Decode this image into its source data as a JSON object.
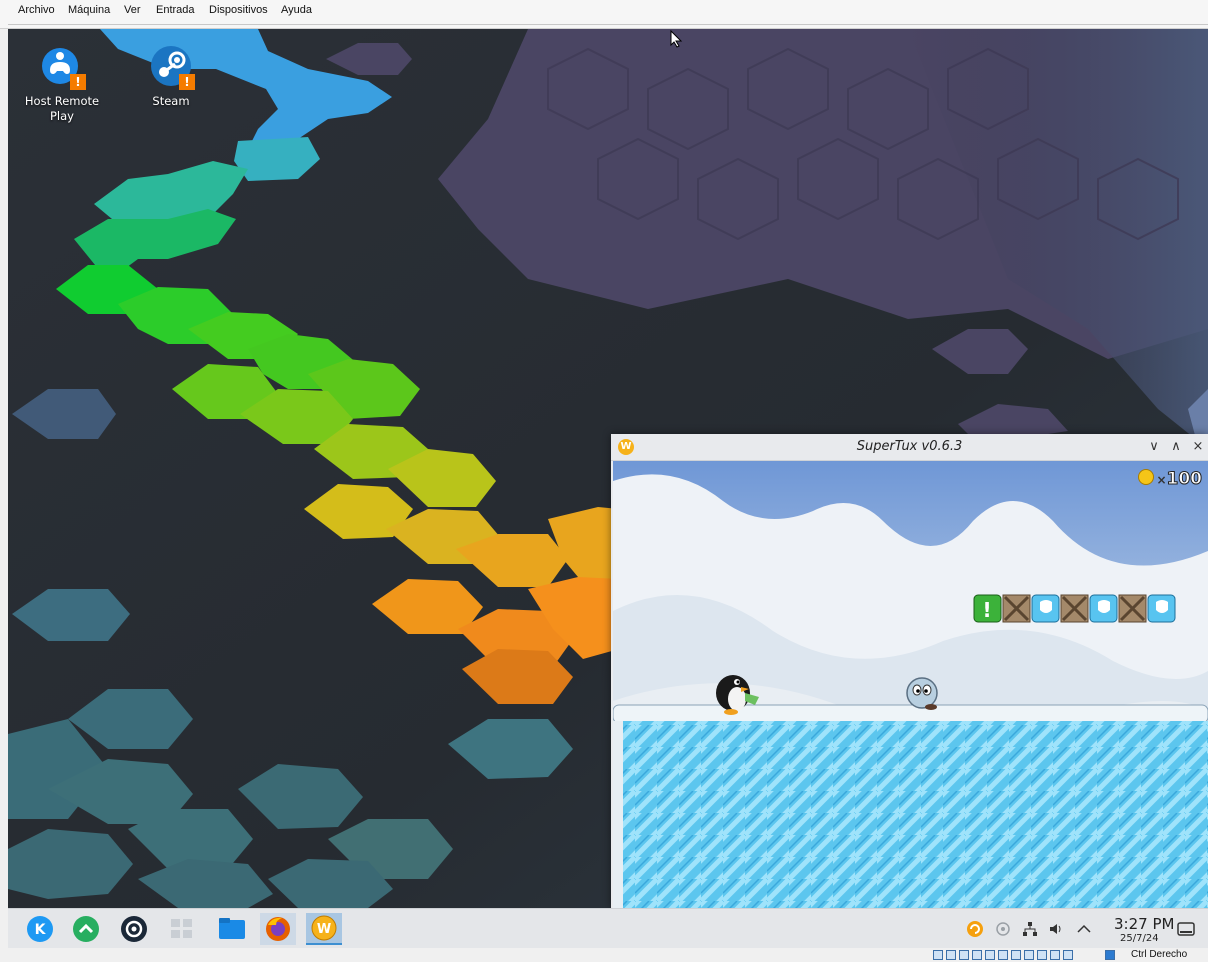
{
  "vbox_menu": {
    "items": [
      "Archivo",
      "Máquina",
      "Ver",
      "Entrada",
      "Dispositivos",
      "Ayuda"
    ]
  },
  "desktop_icons": [
    {
      "label": "Host Remote Play",
      "icon": "gamepad-icon"
    },
    {
      "label": "Steam",
      "icon": "steam-icon"
    }
  ],
  "game_window": {
    "title": "SuperTux v0.6.3",
    "controls": {
      "minimize": "∨",
      "maximize": "∧",
      "close": "×"
    },
    "coins": "100",
    "coin_multiplier": "×"
  },
  "taskbar": {
    "apps": [
      {
        "name": "app-launcher",
        "icon": "kde-icon"
      },
      {
        "name": "discover",
        "icon": "discover-icon"
      },
      {
        "name": "steam",
        "icon": "steam-icon"
      },
      {
        "name": "pager",
        "icon": "virtual-desktops-icon"
      },
      {
        "name": "dolphin",
        "icon": "folder-icon"
      },
      {
        "name": "firefox",
        "icon": "firefox-icon"
      },
      {
        "name": "supertux",
        "icon": "supertux-icon"
      }
    ],
    "time": "3:27 PM",
    "date": "25/7/24"
  },
  "vbox_status": {
    "host_key": "Ctrl Derecho"
  },
  "colors": {
    "accent": "#3d8fd1",
    "warning": "#f57c00"
  }
}
